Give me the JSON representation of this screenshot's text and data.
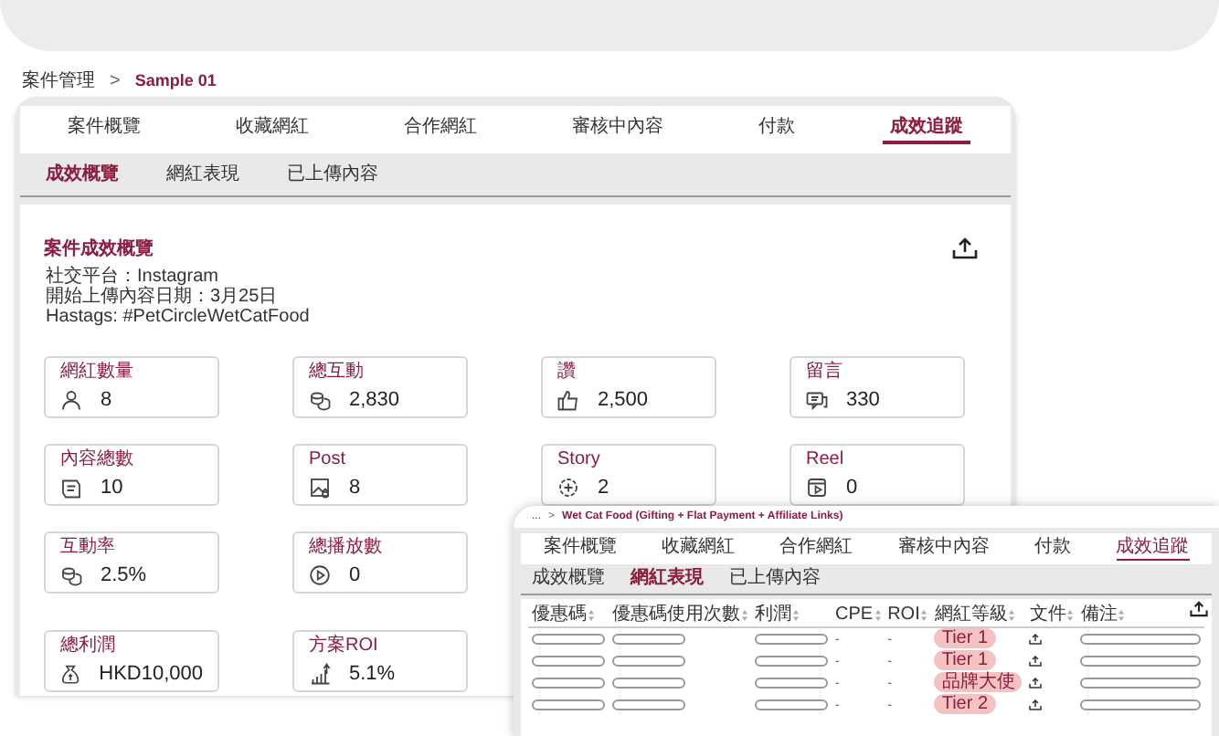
{
  "breadcrumb": {
    "parent": "案件管理",
    "separator": ">",
    "current": "Sample 01"
  },
  "tabs": [
    {
      "label": "案件概覽",
      "selected": false
    },
    {
      "label": "收藏網紅",
      "selected": false
    },
    {
      "label": "合作網紅",
      "selected": false
    },
    {
      "label": "審核中內容",
      "selected": false
    },
    {
      "label": "付款",
      "selected": false
    },
    {
      "label": "成效追蹤",
      "selected": true
    }
  ],
  "subtabs": [
    {
      "label": "成效概覽",
      "selected": true
    },
    {
      "label": "網紅表現",
      "selected": false
    },
    {
      "label": "已上傳內容",
      "selected": false
    }
  ],
  "overview": {
    "title": "案件成效概覽",
    "lines": [
      "社交平台：Instagram",
      "開始上傳內容日期：3月25日",
      "Hastags: #PetCircleWetCatFood"
    ]
  },
  "stats": [
    {
      "label": "網紅數量",
      "value": "8"
    },
    {
      "label": "總互動",
      "value": "2,830"
    },
    {
      "label": "讚",
      "value": "2,500"
    },
    {
      "label": "留言",
      "value": "330"
    },
    {
      "label": "內容總數",
      "value": "10"
    },
    {
      "label": "Post",
      "value": "8"
    },
    {
      "label": "Story",
      "value": "2"
    },
    {
      "label": "Reel",
      "value": "0"
    },
    {
      "label": "互動率",
      "value": "2.5%"
    },
    {
      "label": "總播放數",
      "value": "0"
    },
    {
      "label": "總利潤",
      "value": "HKD10,000"
    },
    {
      "label": "方案ROI",
      "value": "5.1%"
    }
  ],
  "inset": {
    "breadcrumb": {
      "parent": "...",
      "separator": ">",
      "current": "Wet Cat Food (Gifting + Flat Payment + Affiliate Links)"
    },
    "tabs": [
      {
        "label": "案件概覽",
        "selected": false
      },
      {
        "label": "收藏網紅",
        "selected": false
      },
      {
        "label": "合作網紅",
        "selected": false
      },
      {
        "label": "審核中內容",
        "selected": false
      },
      {
        "label": "付款",
        "selected": false
      },
      {
        "label": "成效追蹤",
        "selected": true
      }
    ],
    "subtabs": [
      {
        "label": "成效概覽",
        "selected": false
      },
      {
        "label": "網紅表現",
        "selected": true
      },
      {
        "label": "已上傳內容",
        "selected": false
      }
    ],
    "columns": [
      "優惠碼",
      "優惠碼使用次數",
      "利潤",
      "CPE",
      "ROI",
      "網紅等級",
      "文件",
      "備注"
    ],
    "rows": [
      {
        "cpe": "-",
        "roi": "-",
        "tier": "Tier 1"
      },
      {
        "cpe": "-",
        "roi": "-",
        "tier": "Tier 1"
      },
      {
        "cpe": "-",
        "roi": "-",
        "tier": "品牌大使"
      },
      {
        "cpe": "-",
        "roi": "-",
        "tier": "Tier 2"
      }
    ]
  }
}
